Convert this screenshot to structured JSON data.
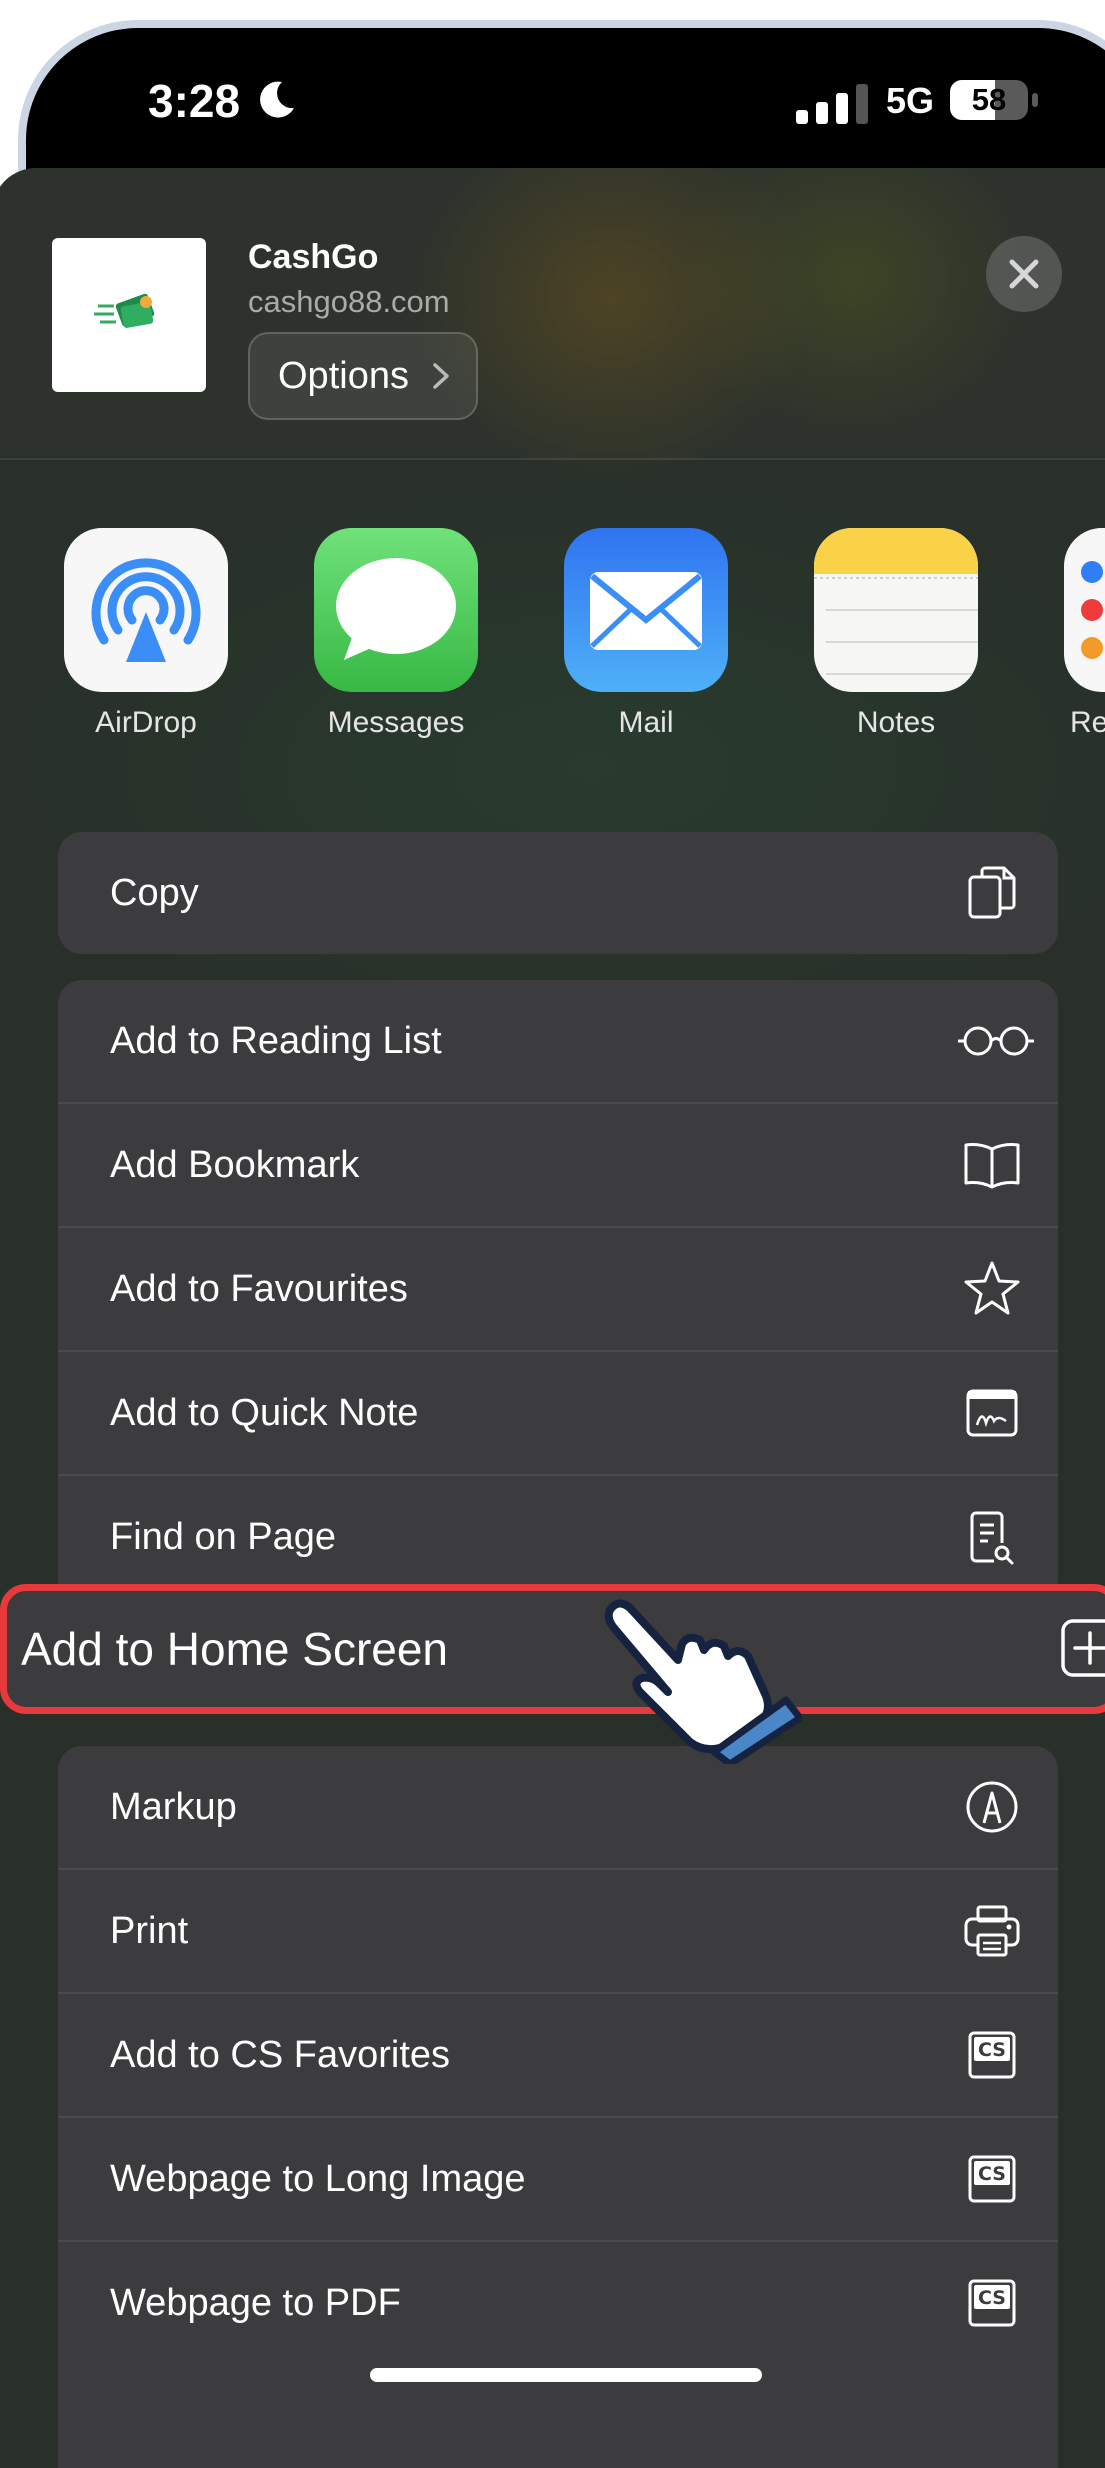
{
  "status_bar": {
    "time": "3:28",
    "network": "5G",
    "battery_percent": 58,
    "battery_text": "58"
  },
  "share_sheet": {
    "site": {
      "title": "CashGo",
      "url": "cashgo88.com"
    },
    "options_label": "Options",
    "apps": [
      {
        "label": "AirDrop",
        "icon": "airdrop-icon"
      },
      {
        "label": "Messages",
        "icon": "messages-icon"
      },
      {
        "label": "Mail",
        "icon": "mail-icon"
      },
      {
        "label": "Notes",
        "icon": "notes-icon"
      },
      {
        "label": "Re",
        "icon": "reminders-icon"
      }
    ],
    "actions_group1": [
      {
        "label": "Copy",
        "icon": "copy-icon"
      }
    ],
    "actions_group2": [
      {
        "label": "Add to Reading List",
        "icon": "glasses-icon"
      },
      {
        "label": "Add Bookmark",
        "icon": "book-icon"
      },
      {
        "label": "Add to Favourites",
        "icon": "star-icon"
      },
      {
        "label": "Add to Quick Note",
        "icon": "quick-note-icon"
      },
      {
        "label": "Find on Page",
        "icon": "find-on-page-icon"
      }
    ],
    "highlighted_action": {
      "label": "Add to Home Screen",
      "icon": "add-square-icon"
    },
    "actions_group3": [
      {
        "label": "Markup",
        "icon": "markup-icon"
      },
      {
        "label": "Print",
        "icon": "printer-icon"
      },
      {
        "label": "Add to CS Favorites",
        "icon": "cs-icon"
      },
      {
        "label": "Webpage to Long Image",
        "icon": "cs-icon"
      },
      {
        "label": "Webpage to PDF",
        "icon": "cs-icon"
      }
    ]
  },
  "colors": {
    "highlight_border": "#e8393d",
    "row_background": "#3c3c3e",
    "mail_blue": "#3a8ef6",
    "messages_green": "#4cd964"
  }
}
